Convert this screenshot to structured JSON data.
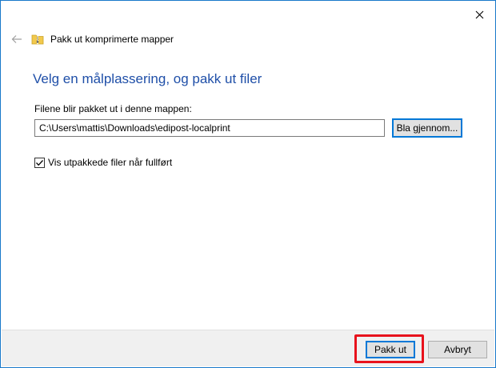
{
  "window": {
    "title": "Pakk ut komprimerte mapper",
    "close_icon": "close-icon",
    "back_icon": "back-arrow-icon",
    "folder_icon": "zip-folder-icon"
  },
  "main": {
    "heading": "Velg en målplassering, og pakk ut filer",
    "path_label": "Filene blir pakket ut i denne mappen:",
    "path_value": "C:\\Users\\mattis\\Downloads\\edipost-localprint",
    "browse_label": "Bla gjennom...",
    "show_files_label": "Vis utpakkede filer når fullført",
    "show_files_checked": true
  },
  "footer": {
    "extract_label": "Pakk ut",
    "cancel_label": "Avbryt"
  },
  "colors": {
    "heading": "#1f4fa8",
    "window_border": "#1979ca",
    "highlight": "#e8121c",
    "focus": "#0078d7"
  }
}
